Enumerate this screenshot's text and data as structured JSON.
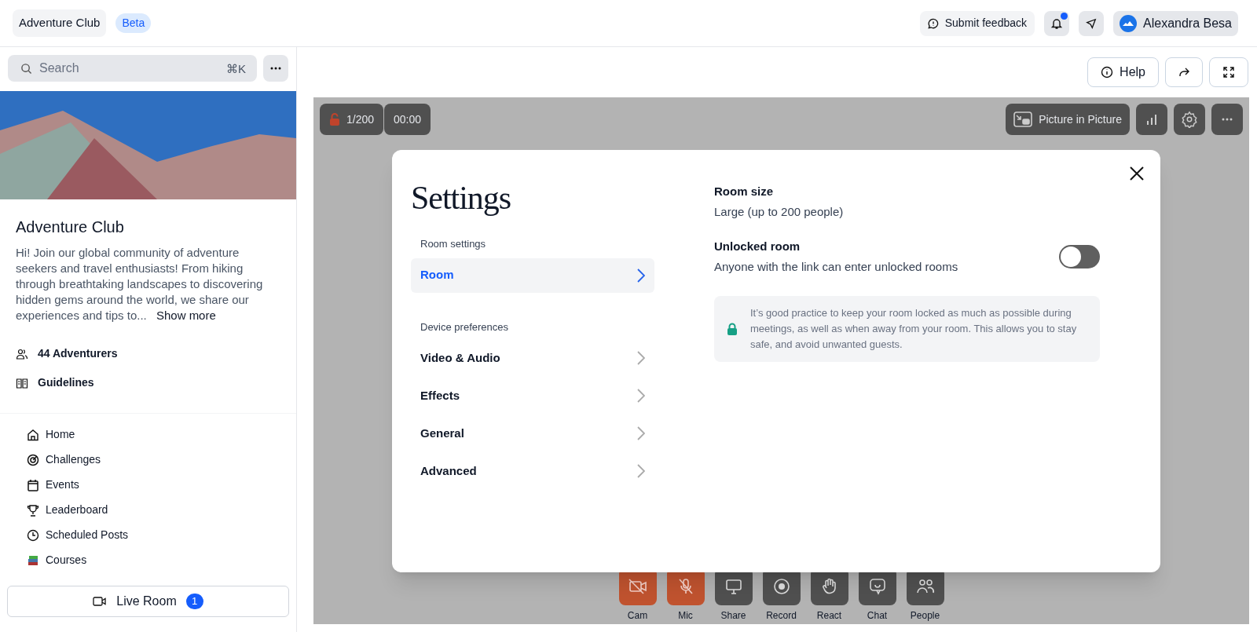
{
  "topbar": {
    "club_name": "Adventure Club",
    "badge": "Beta",
    "feedback": "Submit feedback",
    "notifications_unread": true,
    "user_name": "Alexandra Besa"
  },
  "sidebar": {
    "search": {
      "placeholder": "Search",
      "shortcut": "⌘K"
    },
    "title": "Adventure Club",
    "description": "Hi! Join our global community of adventure seekers and travel enthusiasts! From hiking through breathtaking landscapes to discovering hidden gems around the world, we share our experiences and tips to...",
    "show_more": "Show more",
    "stats": [
      {
        "label": "44 Adventurers"
      },
      {
        "label": "Guidelines"
      }
    ],
    "nav": [
      {
        "label": "Home"
      },
      {
        "label": "Challenges"
      },
      {
        "label": "Events"
      },
      {
        "label": "Leaderboard"
      },
      {
        "label": "Scheduled Posts"
      },
      {
        "label": "Courses"
      }
    ],
    "live_room": {
      "label": "Live Room",
      "count": "1"
    }
  },
  "toolbar": {
    "help": "Help"
  },
  "room": {
    "locked": false,
    "capacity": "1/200",
    "timer": "00:00",
    "pip": "Picture in Picture",
    "controls": [
      {
        "label": "Cam",
        "off": true
      },
      {
        "label": "Mic",
        "off": true
      },
      {
        "label": "Share",
        "off": false
      },
      {
        "label": "Record",
        "off": false
      },
      {
        "label": "React",
        "off": false
      },
      {
        "label": "Chat",
        "off": false
      },
      {
        "label": "People",
        "off": false
      }
    ]
  },
  "settings": {
    "title": "Settings",
    "sections": [
      {
        "heading": "Room settings",
        "items": [
          {
            "label": "Room",
            "selected": true
          }
        ]
      },
      {
        "heading": "Device preferences",
        "items": [
          {
            "label": "Video & Audio",
            "selected": false
          },
          {
            "label": "Effects",
            "selected": false
          },
          {
            "label": "General",
            "selected": false
          },
          {
            "label": "Advanced",
            "selected": false
          }
        ]
      }
    ],
    "room_size": {
      "title": "Room size",
      "value": "Large (up to 200 people)"
    },
    "unlocked": {
      "title": "Unlocked room",
      "description": "Anyone with the link can enter unlocked rooms",
      "on": false
    },
    "tip": "It’s good practice to keep your room locked as much as possible during meetings, as well as when away from your room. This allows you to stay safe, and avoid unwanted guests."
  }
}
